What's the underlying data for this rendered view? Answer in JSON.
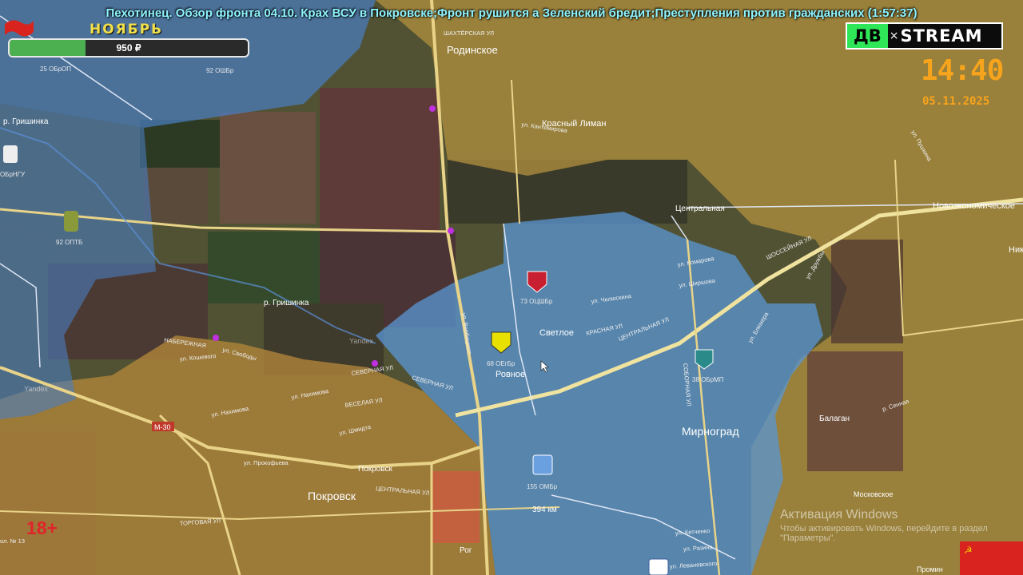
{
  "overlay": {
    "title": "Пехотинец. Обзор фронта 04.10. Крах ВСУ в Покровске;Фронт рушится а Зеленский бредит;Преступления против гражданских (1:57:37)",
    "month": "НОЯБРЬ",
    "donation_amount": "950 ₽",
    "donation_progress": 0.32,
    "clock": "14:40",
    "date": "05.11.2025",
    "age_rating": "18+",
    "logo_left": "ДВ",
    "logo_sep": "×",
    "logo_right": "STREAM"
  },
  "windows_activation": {
    "line1": "Активация Windows",
    "line2": "Чтобы активировать Windows, перейдите в раздел",
    "line3": "\"Параметры\"."
  },
  "map": {
    "places": {
      "rodinskoe": "Родинское",
      "krasny_liman": "Красный Лиман",
      "tsentralnaya": "Центральная",
      "novoekonomicheskoe": "Новоэкономическое",
      "svetloe": "Светлое",
      "rovnoe": "Ровное",
      "mirnograd": "Мирноград",
      "pokrovsk_big": "Покровск",
      "pokrovsk_station": "Покровск",
      "balagan": "Балаган",
      "moskovskoe": "Московское",
      "promin": "Промин",
      "rog": "Рог",
      "nik": "Ник",
      "r_grishinka_1": "р. Гришинка",
      "r_grishinka_2": "р. Гришинка",
      "km394": "394 км",
      "m30": "М-30",
      "yandex1": "Yandex",
      "yandex2": "Yandex"
    },
    "units": {
      "u25": "25 ОБрОП",
      "u92a": "92 ОШБр",
      "u92b": "92 ОПТБ",
      "ungu": "ОБрНГУ",
      "u73": "73 ОЦШБр",
      "u68": "68 ОЕгБр",
      "u38": "38 ОБрМП",
      "u155": "155 ОМБр"
    },
    "streets": {
      "s1": "ул. Кантемирова",
      "s2": "ШАХТЁРСКАЯ УЛ",
      "s3": "ШОССЕЙНАЯ УЛ",
      "s4": "ул. Комарова",
      "s5": "ул. Ширшова",
      "s6": "ул. Челюскина",
      "s7": "КРАСНАЯ УЛ",
      "s8": "ЦЕНТРАЛЬНАЯ УЛ",
      "s9": "СОБОРНАЯ УЛ",
      "s10": "НАБЕРЕЖНАЯ",
      "s11": "ул. Кошевого",
      "s12": "ул. Свободы",
      "s13": "СЕВЕРНАЯ УЛ",
      "s14": "ул. Нахимова",
      "s15": "ВЕСЕЛАЯ УЛ",
      "s16": "ул. Шмидта",
      "s17": "ул. Прокофьева",
      "s18": "ЦЕНТРАЛЬНАЯ УЛ",
      "s19": "ТОРГОВАЯ УЛ",
      "s20": "ул. Кетченко",
      "s21": "ул. Разина",
      "s22": "ул. Леваневского",
      "s23": "р. Сенная",
      "s24": "ул. Пушкина",
      "s25": "ул. Дружбы",
      "s26": "СЕВЕРНАЯ УЛ",
      "s27": "ул. Блюхера",
      "s28": "ул. Вербицкого",
      "s29": "ул. Нахимова",
      "s30": "ол. № 13"
    }
  }
}
